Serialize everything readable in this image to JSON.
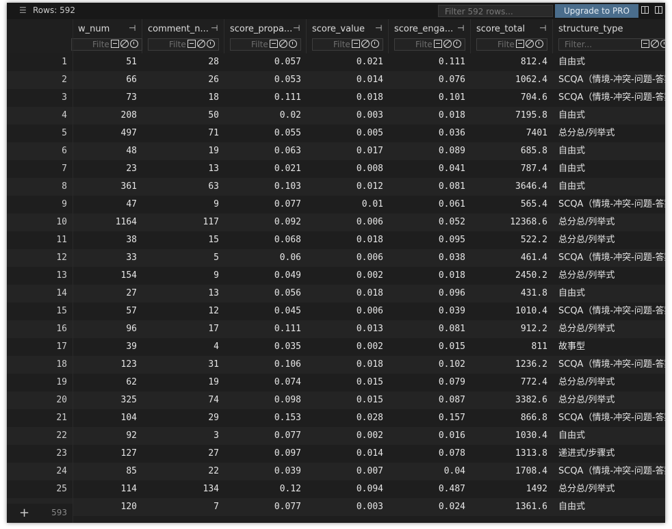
{
  "toolbar": {
    "menu_icon": "hamburger-menu-icon",
    "rows_label": "Rows: 592",
    "filter_placeholder": "Filter 592 rows...",
    "upgrade_label": "Upgrade to PRO"
  },
  "columns": [
    {
      "title": "w_num",
      "filter_placeholder": "Filte"
    },
    {
      "title": "comment_n...",
      "filter_placeholder": "Filte"
    },
    {
      "title": "score_propa...",
      "filter_placeholder": "Filte"
    },
    {
      "title": "score_value",
      "filter_placeholder": "Filte"
    },
    {
      "title": "score_enga...",
      "filter_placeholder": "Filte"
    },
    {
      "title": "score_total",
      "filter_placeholder": "Filte"
    },
    {
      "title": "structure_type",
      "filter_placeholder": "Filter..."
    }
  ],
  "rows": [
    {
      "n": "1",
      "c": [
        "51",
        "28",
        "0.057",
        "0.021",
        "0.111",
        "812.4",
        "自由式"
      ]
    },
    {
      "n": "2",
      "c": [
        "66",
        "26",
        "0.053",
        "0.014",
        "0.076",
        "1062.4",
        "SCQA（情境-冲突-问题-答案）"
      ]
    },
    {
      "n": "3",
      "c": [
        "73",
        "18",
        "0.111",
        "0.018",
        "0.101",
        "704.6",
        "SCQA（情境-冲突-问题-答案）"
      ]
    },
    {
      "n": "4",
      "c": [
        "208",
        "50",
        "0.02",
        "0.003",
        "0.018",
        "7195.8",
        "自由式"
      ]
    },
    {
      "n": "5",
      "c": [
        "497",
        "71",
        "0.055",
        "0.005",
        "0.036",
        "7401",
        "总分总/列举式"
      ]
    },
    {
      "n": "6",
      "c": [
        "48",
        "19",
        "0.063",
        "0.017",
        "0.089",
        "685.8",
        "自由式"
      ]
    },
    {
      "n": "7",
      "c": [
        "23",
        "13",
        "0.021",
        "0.008",
        "0.041",
        "787.4",
        "自由式"
      ]
    },
    {
      "n": "8",
      "c": [
        "361",
        "63",
        "0.103",
        "0.012",
        "0.081",
        "3646.4",
        "自由式"
      ]
    },
    {
      "n": "9",
      "c": [
        "47",
        "9",
        "0.077",
        "0.01",
        "0.061",
        "565.4",
        "SCQA（情境-冲突-问题-答案）"
      ]
    },
    {
      "n": "10",
      "c": [
        "1164",
        "117",
        "0.092",
        "0.006",
        "0.052",
        "12368.6",
        "总分总/列举式"
      ]
    },
    {
      "n": "11",
      "c": [
        "38",
        "15",
        "0.068",
        "0.018",
        "0.095",
        "522.2",
        "总分总/列举式"
      ]
    },
    {
      "n": "12",
      "c": [
        "33",
        "5",
        "0.06",
        "0.006",
        "0.038",
        "461.4",
        "SCQA（情境-冲突-问题-答案）"
      ]
    },
    {
      "n": "13",
      "c": [
        "154",
        "9",
        "0.049",
        "0.002",
        "0.018",
        "2450.2",
        "总分总/列举式"
      ]
    },
    {
      "n": "14",
      "c": [
        "27",
        "13",
        "0.056",
        "0.018",
        "0.096",
        "431.8",
        "自由式"
      ]
    },
    {
      "n": "15",
      "c": [
        "57",
        "12",
        "0.045",
        "0.006",
        "0.039",
        "1010.4",
        "SCQA（情境-冲突-问题-答案）"
      ]
    },
    {
      "n": "16",
      "c": [
        "96",
        "17",
        "0.111",
        "0.013",
        "0.081",
        "912.2",
        "总分总/列举式"
      ]
    },
    {
      "n": "17",
      "c": [
        "39",
        "4",
        "0.035",
        "0.002",
        "0.015",
        "811",
        "故事型"
      ]
    },
    {
      "n": "18",
      "c": [
        "123",
        "31",
        "0.106",
        "0.018",
        "0.102",
        "1236.2",
        "SCQA（情境-冲突-问题-答案）"
      ]
    },
    {
      "n": "19",
      "c": [
        "62",
        "19",
        "0.074",
        "0.015",
        "0.079",
        "772.4",
        "总分总/列举式"
      ]
    },
    {
      "n": "20",
      "c": [
        "325",
        "74",
        "0.098",
        "0.015",
        "0.087",
        "3382.6",
        "总分总/列举式"
      ]
    },
    {
      "n": "21",
      "c": [
        "104",
        "29",
        "0.153",
        "0.028",
        "0.157",
        "866.8",
        "SCQA（情境-冲突-问题-答案）"
      ]
    },
    {
      "n": "22",
      "c": [
        "92",
        "3",
        "0.077",
        "0.002",
        "0.016",
        "1030.4",
        "自由式"
      ]
    },
    {
      "n": "23",
      "c": [
        "127",
        "27",
        "0.097",
        "0.014",
        "0.078",
        "1313.8",
        "递进式/步骤式"
      ]
    },
    {
      "n": "24",
      "c": [
        "85",
        "22",
        "0.039",
        "0.007",
        "0.04",
        "1708.4",
        "SCQA（情境-冲突-问题-答案）"
      ]
    },
    {
      "n": "25",
      "c": [
        "114",
        "134",
        "0.12",
        "0.094",
        "0.487",
        "1492",
        "总分总/列举式"
      ]
    },
    {
      "n": "",
      "c": [
        "120",
        "7",
        "0.077",
        "0.003",
        "0.024",
        "1361.6",
        "自由式"
      ]
    }
  ],
  "footer": {
    "add_icon": "plus-icon",
    "new_row_number": "593"
  }
}
